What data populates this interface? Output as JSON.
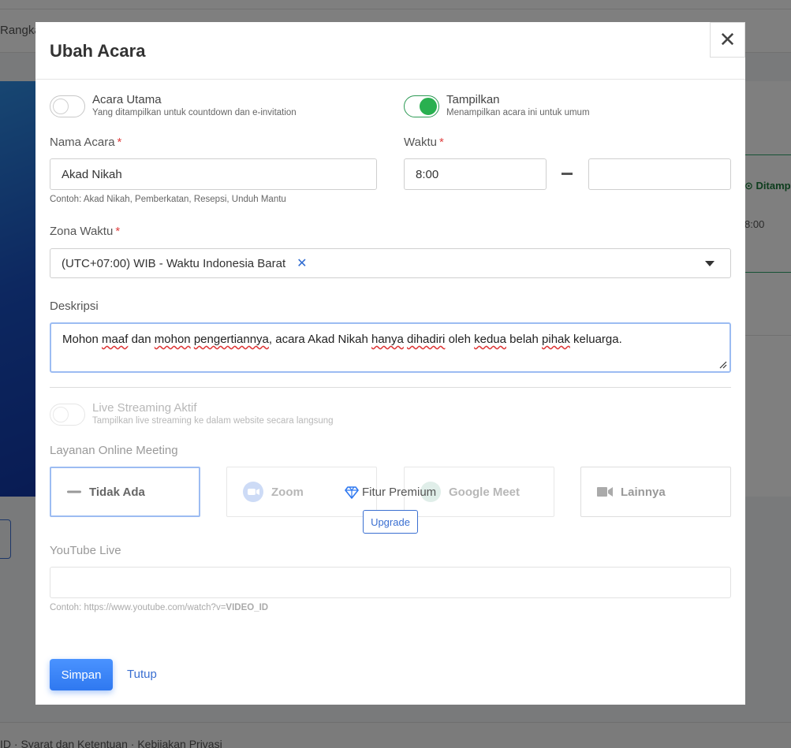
{
  "background": {
    "subnav_text": "Rangka",
    "card_label": "⊙ Ditamp",
    "card_time": "8:00",
    "footer_text": "ID · Syarat dan Ketentuan · Kebijakan Privasi"
  },
  "modal": {
    "title": "Ubah Acara",
    "close_icon": "close-icon",
    "main_event": {
      "title": "Acara Utama",
      "subtitle": "Yang ditampilkan untuk countdown dan e-invitation",
      "enabled": false
    },
    "display": {
      "title": "Tampilkan",
      "subtitle": "Menampilkan acara ini untuk umum",
      "enabled": true
    },
    "event_name": {
      "label": "Nama Acara",
      "required_mark": "*",
      "value": "Akad Nikah",
      "hint": "Contoh: Akad Nikah, Pemberkatan, Resepsi, Unduh Mantu"
    },
    "time": {
      "label": "Waktu",
      "required_mark": "*",
      "start": "8:00",
      "end": ""
    },
    "timezone": {
      "label": "Zona Waktu",
      "required_mark": "*",
      "value": "(UTC+07:00) WIB - Waktu Indonesia Barat",
      "clear": "✕"
    },
    "description": {
      "label": "Deskripsi",
      "words": [
        {
          "t": "Mohon ",
          "m": false
        },
        {
          "t": "maaf",
          "m": true
        },
        {
          "t": " dan ",
          "m": false
        },
        {
          "t": "mohon",
          "m": true
        },
        {
          "t": " ",
          "m": false
        },
        {
          "t": "pengertiannya",
          "m": true
        },
        {
          "t": ", acara Akad Nikah ",
          "m": false
        },
        {
          "t": "hanya",
          "m": true
        },
        {
          "t": " ",
          "m": false
        },
        {
          "t": "dihadiri",
          "m": true
        },
        {
          "t": " oleh ",
          "m": false
        },
        {
          "t": "kedua",
          "m": true
        },
        {
          "t": " belah ",
          "m": false
        },
        {
          "t": "pihak",
          "m": true
        },
        {
          "t": " keluarga.",
          "m": false
        }
      ]
    },
    "live_streaming": {
      "title": "Live Streaming Aktif",
      "subtitle": "Tampilkan live streaming ke dalam website secara langsung",
      "enabled": false
    },
    "online_meeting": {
      "label": "Layanan Online Meeting",
      "options": [
        {
          "label": "Tidak Ada",
          "icon": "minus-icon",
          "selected": true
        },
        {
          "label": "Zoom",
          "icon": "zoom-icon",
          "selected": false
        },
        {
          "label": "Google Meet",
          "icon": "google-meet-icon",
          "selected": false
        },
        {
          "label": "Lainnya",
          "icon": "video-camera-icon",
          "selected": false
        }
      ],
      "premium_label": "Fitur Premium",
      "premium_icon": "diamond-icon",
      "upgrade_label": "Upgrade"
    },
    "youtube": {
      "label": "YouTube Live",
      "value": "",
      "hint_prefix": "Contoh: https://www.youtube.com/watch?v=",
      "hint_bold": "VIDEO_ID"
    },
    "actions": {
      "save_label": "Simpan",
      "close_label": "Tutup"
    }
  },
  "colors": {
    "primary": "#2f78f0",
    "toggle_on": "#29b050",
    "required": "#e04040",
    "focus_border": "#9cbcf2"
  }
}
